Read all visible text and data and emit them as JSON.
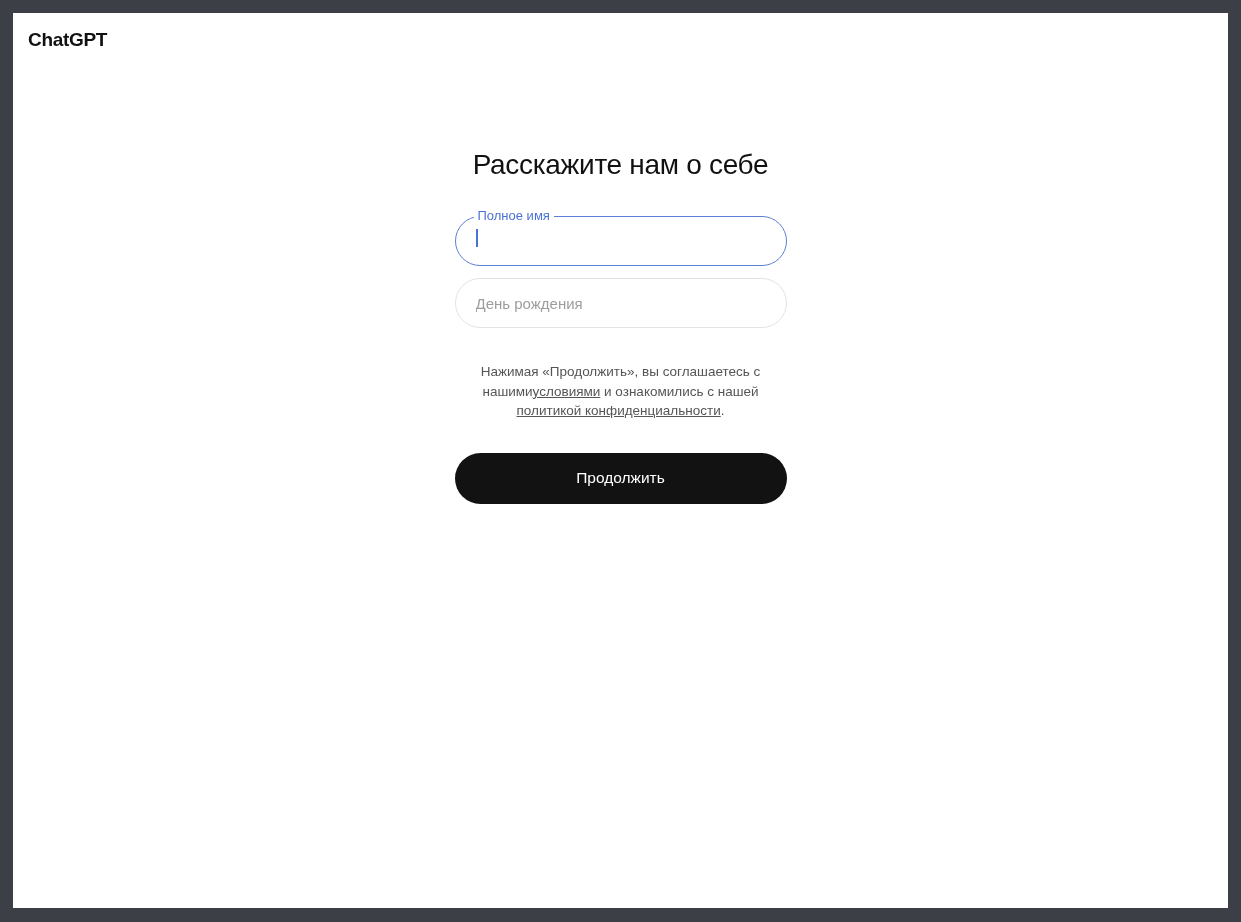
{
  "logo": "ChatGPT",
  "heading": "Расскажите нам о себе",
  "fields": [
    {
      "label": "Полное имя",
      "focused": true
    },
    {
      "placeholder": "День рождения",
      "focused": false
    }
  ],
  "terms": [
    {
      "kind": "text",
      "text": "Нажимая «Продолжить», вы соглашаетесь с нашими"
    },
    {
      "kind": "link",
      "text": "условиями"
    },
    {
      "kind": "text",
      "text": " и ознакомились с нашей "
    },
    {
      "kind": "link",
      "text": "политикой конфиденциальности"
    },
    {
      "kind": "text",
      "text": "."
    }
  ],
  "button": "Продолжить"
}
